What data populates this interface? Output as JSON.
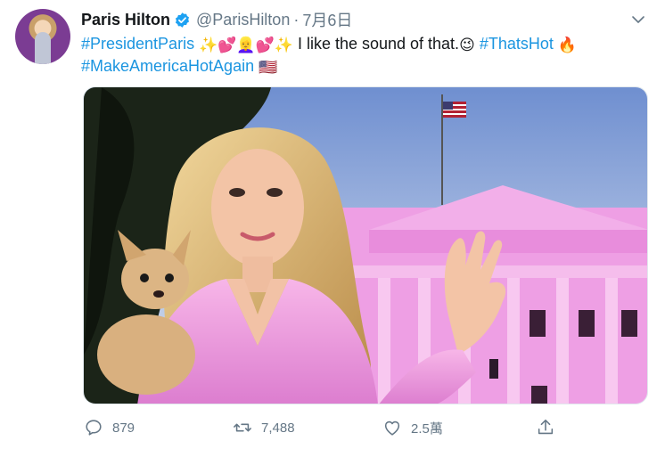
{
  "tweet": {
    "author_name": "Paris Hilton",
    "author_handle": "@ParisHilton",
    "separator": "·",
    "date": "7月6日",
    "text_segments": {
      "h1": "#PresidentParis",
      "e1": "✨💕👱‍♀️💕✨",
      "t1": " I like the sound of that.",
      "e2": "😉",
      "h2": "#ThatsHot",
      "e3": "🔥",
      "h3": "#MakeAmericaHotAgain",
      "e4": "🇺🇸"
    }
  },
  "actions": {
    "reply_count": "879",
    "retweet_count": "7,488",
    "like_count": "2.5萬"
  },
  "colors": {
    "hashtag": "#1b95e0",
    "secondary_text": "#657786",
    "verified": "#1da1f2",
    "pink_house": "#ea8ee0"
  }
}
